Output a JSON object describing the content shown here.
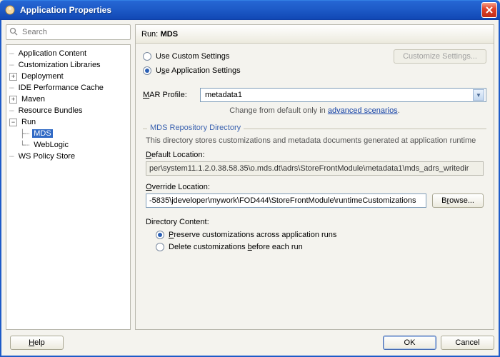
{
  "title": "Application Properties",
  "search": {
    "placeholder": "Search"
  },
  "tree": {
    "app_content": "Application Content",
    "custom_libs": "Customization Libraries",
    "deployment": "Deployment",
    "ide_cache": "IDE Performance Cache",
    "maven": "Maven",
    "resource_bundles": "Resource Bundles",
    "run": "Run",
    "run_mds": "MDS",
    "run_weblogic": "WebLogic",
    "ws_policy": "WS Policy Store"
  },
  "header": {
    "prefix": "Run: ",
    "section": "MDS"
  },
  "settings": {
    "use_custom": "Use Custom Settings",
    "use_app_pre": "U",
    "use_app_accel": "s",
    "use_app_post": "e Application Settings",
    "customize_btn": "Customize Settings..."
  },
  "mar": {
    "label_pre": "",
    "label_accel": "M",
    "label_post": "AR Profile:",
    "value": "metadata1",
    "hint_pre": "Change from default only in ",
    "hint_link": "advanced scenarios"
  },
  "group": {
    "legend": "MDS Repository Directory",
    "desc": "This directory stores customizations and metadata documents generated at application runtime",
    "default_pre": "",
    "default_accel": "D",
    "default_post": "efault Location:",
    "default_value": "per\\system11.1.2.0.38.58.35\\o.mds.dt\\adrs\\StoreFrontModule\\metadata1\\mds_adrs_writedir",
    "override_pre": "",
    "override_accel": "O",
    "override_post": "verride Location:",
    "override_value": "-5835\\jdeveloper\\mywork\\FOD444\\StoreFrontModule\\runtimeCustomizations",
    "browse_pre": "B",
    "browse_accel": "r",
    "browse_post": "owse..."
  },
  "dc": {
    "label": "Directory Content:",
    "preserve_pre": "",
    "preserve_accel": "P",
    "preserve_post": "reserve customizations across application runs",
    "delete_pre": "Delete customizations ",
    "delete_accel": "b",
    "delete_post": "efore each run"
  },
  "footer": {
    "help_pre": "",
    "help_accel": "H",
    "help_post": "elp",
    "ok": "OK",
    "cancel": "Cancel"
  }
}
